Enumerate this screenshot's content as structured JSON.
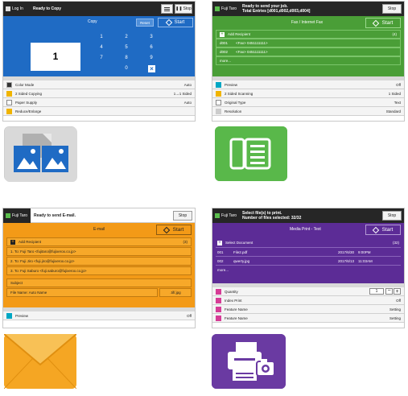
{
  "copy": {
    "login": "Log In",
    "status": "Ready to Copy",
    "menu_icon": "hamburger-icon",
    "stop": "Stop",
    "title": "Copy",
    "reset": "Reset",
    "start": "Start",
    "quantity": "1",
    "keys": [
      "1",
      "2",
      "3",
      "4",
      "5",
      "6",
      "7",
      "8",
      "9",
      "0"
    ],
    "clear_icon": "clear-x-icon",
    "settings": [
      {
        "label": "Color Mode",
        "value": "Auto"
      },
      {
        "label": "2 Sided Copying",
        "value": "1→1 Sided"
      },
      {
        "label": "Paper Supply",
        "value": "Auto"
      },
      {
        "label": "Reduce/Enlarge",
        "value": ""
      }
    ]
  },
  "fax": {
    "user": "Fuji Taro",
    "status_line1": "Ready to send your job.",
    "status_line2": "Total Entries [d001,d002,d003,d004]",
    "stop": "Stop",
    "title": "Fax / Internet Fax",
    "start": "Start",
    "add_recipient": "Add Recipient",
    "count": "(4)",
    "recipients": [
      {
        "id": "d001",
        "text": "<Fax> 0451111111>"
      },
      {
        "id": "d002",
        "text": "<Fax> 0451111111>"
      }
    ],
    "more": "more...",
    "settings": [
      {
        "label": "Preview",
        "value": "Off"
      },
      {
        "label": "2 Sided Scanning",
        "value": "1 Sided"
      },
      {
        "label": "Original Type",
        "value": "Text"
      },
      {
        "label": "Resolution",
        "value": "Standard"
      }
    ]
  },
  "email": {
    "user": "Fuji Taro",
    "status": "Ready to send E-mail.",
    "stop": "Stop",
    "title": "E-mail",
    "start": "Start",
    "add_recipient": "Add Recipient",
    "count": "(3)",
    "recipients": [
      "1. To:  Fuji Taro <fujitaro@fujixerox.co.jp>",
      "2. To:  Fuji Jiro <fuji.jiro@fujixerox.co.jp>",
      "3. To:  Fuji Saburo <fuji.saburo@fujixerox.co.jp>"
    ],
    "subject": "Subject",
    "file_name": "File Name: Auto Name",
    "ext": ".tif/.jpg",
    "settings": [
      {
        "label": "Preview",
        "value": "Off"
      }
    ]
  },
  "print": {
    "user": "Fuji Taro",
    "status_line1": "Select file(s) to print.",
    "status_line2": "Number of files selected: 32/32",
    "stop": "Stop",
    "title": "Media Print - Text",
    "start": "Start",
    "select_document": "Select Document",
    "count": "(32)",
    "files": [
      {
        "id": "001",
        "name": "File2.pdf",
        "date": "2017/6/30",
        "time": "9:00PM"
      },
      {
        "id": "002",
        "name": "qwerty.jpg",
        "date": "2017/6/13",
        "time": "11:03AM"
      }
    ],
    "more": "more...",
    "quantity_value": "1",
    "settings": [
      {
        "label": "Quantity",
        "value": ""
      },
      {
        "label": "Index Print",
        "value": "Off"
      },
      {
        "label": "Feature Name",
        "value": "Setting"
      },
      {
        "label": "Feature Name",
        "value": "Setting"
      }
    ]
  },
  "icons": {
    "copy_app": "copy-documents-icon",
    "fax_app": "fax-phone-icon",
    "email_app": "envelope-icon",
    "print_app": "media-print-icon"
  },
  "colors": {
    "copy_blue": "#1f6bc4",
    "fax_green": "#4a9e37",
    "email_orange": "#f39a17",
    "print_purple": "#5c2c96",
    "fax_icon_green": "#59b84a",
    "print_icon_purple": "#6a3aa2"
  }
}
